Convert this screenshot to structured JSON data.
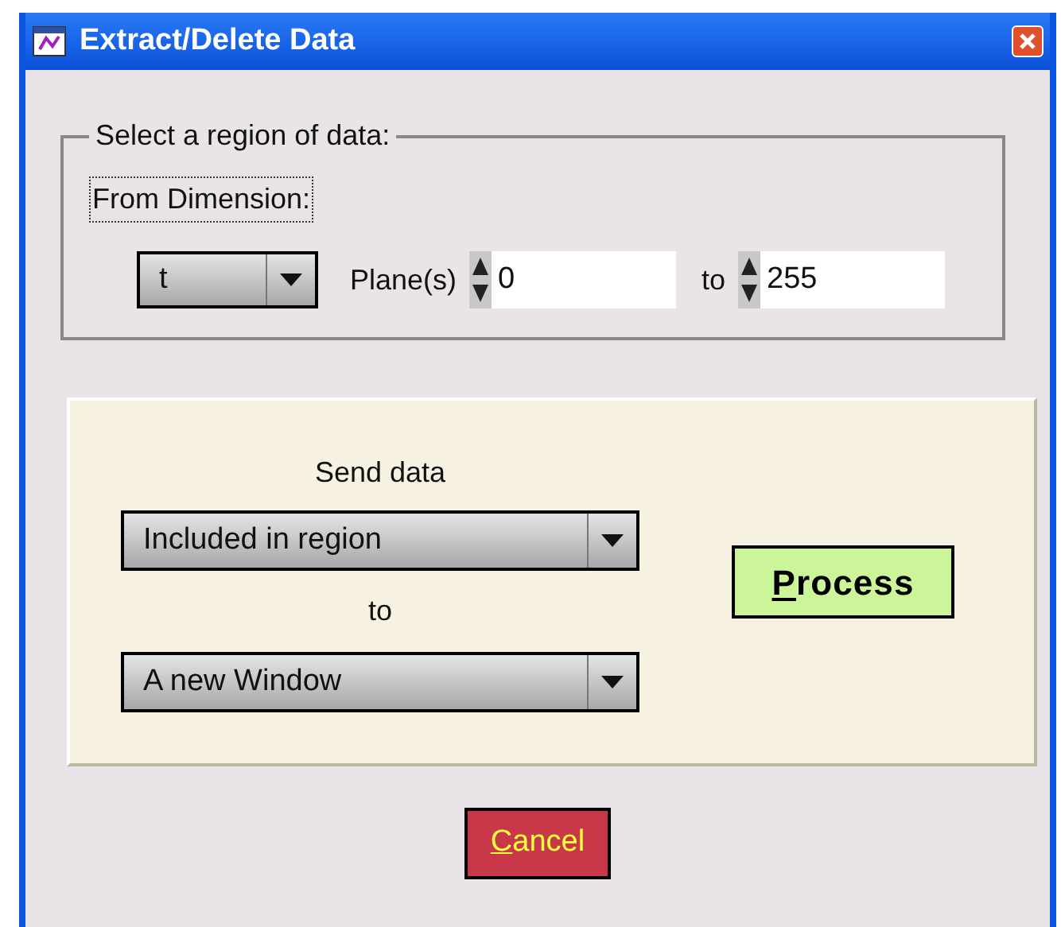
{
  "window": {
    "title": "Extract/Delete Data"
  },
  "region": {
    "legend": "Select a region of data:",
    "dimension_label": "From Dimension:",
    "dimension": "t",
    "planes_label": "Plane(s)",
    "from_value": "0",
    "to_label": "to",
    "to_value": "255"
  },
  "send": {
    "label": "Send data",
    "mode": "Included in region",
    "to_label": "to",
    "destination": "A new Window"
  },
  "buttons": [
    {
      "kind": "process",
      "mnemonic": "P",
      "rest": "rocess"
    },
    {
      "kind": "cancel",
      "mnemonic": "C",
      "rest": "ancel"
    }
  ]
}
